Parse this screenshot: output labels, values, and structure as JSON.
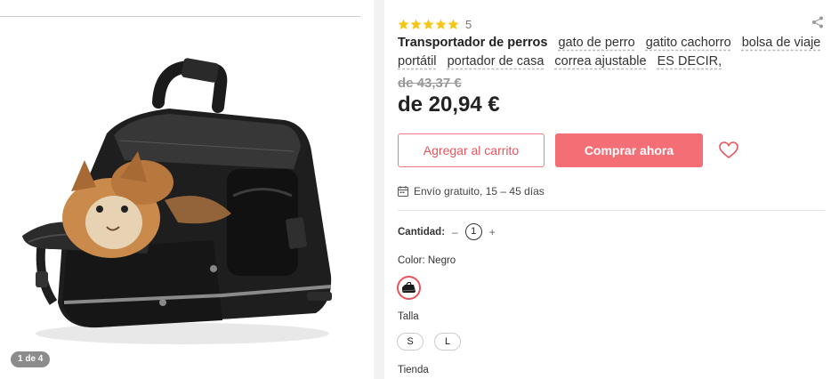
{
  "gallery": {
    "image_name": "pet-carrier-bag-with-cat-photo",
    "page_indicator": "1 de 4"
  },
  "rating": {
    "stars": 5,
    "count": "5",
    "star_color": "#f5c518"
  },
  "title": {
    "main": "Transportador de perros",
    "tags": [
      "gato de perro",
      "gatito cachorro",
      "bolsa de viaje portátil",
      "portador de casa",
      "correa ajustable",
      "ES DECIR,"
    ]
  },
  "price": {
    "old": "de 43,37 €",
    "current": "de 20,94 €"
  },
  "actions": {
    "add_to_cart": "Agregar al carrito",
    "buy_now": "Comprar ahora",
    "accent_color": "#f46f75"
  },
  "shipping": {
    "text": "Envío gratuito, 15 – 45 días"
  },
  "quantity": {
    "label": "Cantidad:",
    "minus": "–",
    "value": "1",
    "plus": "+"
  },
  "color": {
    "label": "Color: Negro",
    "selected_swatch": "black-carrier-bag-swatch"
  },
  "size": {
    "label": "Talla",
    "options": [
      "S",
      "L"
    ]
  },
  "store": {
    "label": "Tienda"
  },
  "icons": {
    "share": "share-icon",
    "favorite": "heart-icon",
    "calendar": "calendar-icon"
  }
}
